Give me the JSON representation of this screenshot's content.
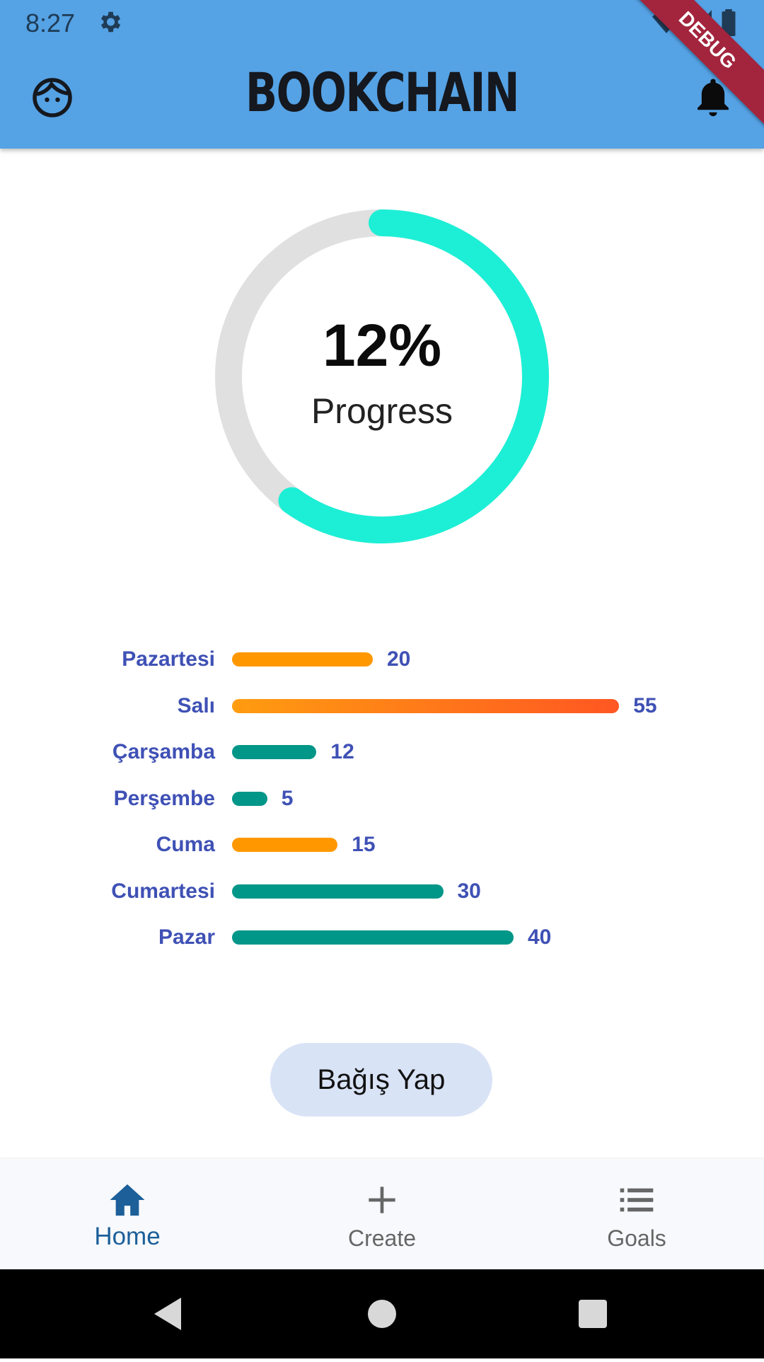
{
  "status_bar": {
    "time": "8:27"
  },
  "app_bar": {
    "title": "BOOKCHAIN",
    "debug_banner": "DEBUG"
  },
  "progress": {
    "value": 0.12,
    "display": "12%",
    "label": "Progress",
    "track_color": "#E0E0E0",
    "fill_color": "#1DEFD6"
  },
  "chart_data": {
    "type": "bar",
    "orientation": "horizontal",
    "categories": [
      "Pazartesi",
      "Salı",
      "Çarşamba",
      "Perşembe",
      "Cuma",
      "Cumartesi",
      "Pazar"
    ],
    "values": [
      20,
      55,
      12,
      5,
      15,
      30,
      40
    ],
    "value_labels": [
      "20",
      "55",
      "12",
      "5",
      "15",
      "30",
      "40"
    ],
    "bar_colors": [
      "#FF9800",
      "gradient-orange",
      "#009688",
      "#009688",
      "#FF9800",
      "#009688",
      "#009688"
    ]
  },
  "donate_button": {
    "label": "Bağış Yap"
  },
  "bottom_nav": [
    {
      "label": "Home",
      "icon": "home-icon",
      "active": true
    },
    {
      "label": "Create",
      "icon": "plus-icon",
      "active": false
    },
    {
      "label": "Goals",
      "icon": "list-icon",
      "active": false
    }
  ],
  "colors": {
    "app_bar": "#55A2E5",
    "active_nav": "#1C5F99",
    "inactive_nav": "#666666",
    "chart_text": "#3F51B5"
  }
}
